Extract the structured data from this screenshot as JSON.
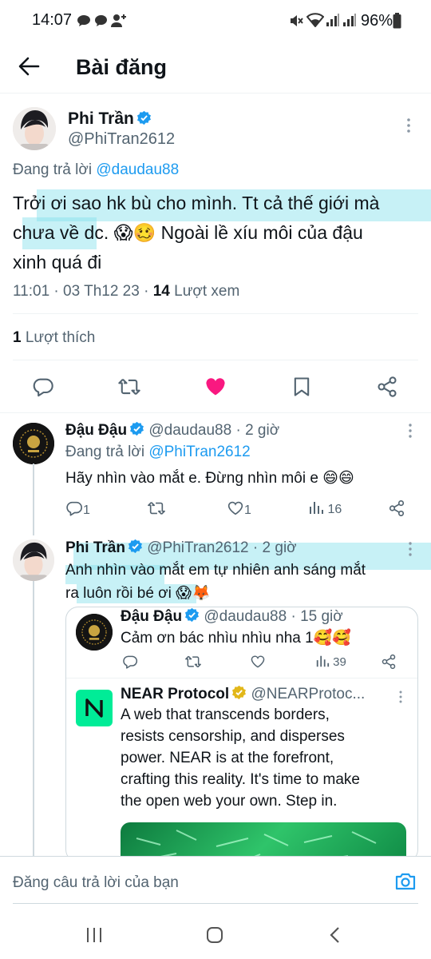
{
  "status_bar": {
    "time": "14:07",
    "battery": "96%",
    "icons": [
      "chat-bubble-icon",
      "chat-bubble-icon",
      "heart-icon",
      "add-person-icon",
      "mute-icon",
      "wifi-icon",
      "signal-icon",
      "signal-icon",
      "battery-icon"
    ]
  },
  "header": {
    "title": "Bài đăng",
    "back_icon": "arrow-left-icon"
  },
  "main_post": {
    "name": "Phi Trần",
    "handle": "@PhiTran2612",
    "replying_prefix": "Đang trả lời ",
    "replying_to": "@daudau88",
    "text_line1": "Trởi ơi sao hk bù cho mình. Tt cả thế giới mà",
    "text_line2": "chưa về dc. 😱🥴 Ngoài lề xíu môi của đậu",
    "text_line3": "xinh quá đi",
    "meta_time": "11:01 · 03 Th12 23 · ",
    "views_count": "14",
    "views_label": " Lượt xem",
    "likes_count": "1",
    "likes_label": " Lượt thích"
  },
  "reply1": {
    "name": "Đậu Đậu",
    "handle": "@daudau88",
    "time": " · 2 giờ",
    "replying_prefix": "Đang trả lời ",
    "replying_to": "@PhiTran2612",
    "text": "Hãy nhìn vào mắt e. Đừng nhìn môi e 😄😄",
    "reply_count": "1",
    "like_count": "1",
    "view_count": "16"
  },
  "reply2": {
    "name": "Phi Trần",
    "handle": "@PhiTran2612",
    "time": " · 2 giờ",
    "text_line1": "Anh nhìn vào mắt em tự nhiên anh sáng mắt",
    "text_line2": "ra luôn rồi bé ơi 😱🦊"
  },
  "quote": {
    "name": "Đậu Đậu",
    "handle": "@daudau88",
    "time": " · 15 giờ",
    "text": "Cảm ơn bác nhìu nhìu nha 1🥰🥰",
    "view_count": "39"
  },
  "near": {
    "name": "NEAR Protocol",
    "handle": "@NEARProtoc...",
    "line1": "A web that transcends borders,",
    "line2": "resists censorship, and disperses",
    "line3": "power. NEAR is at the forefront,",
    "line4": "crafting this reality. It's time to make",
    "line5": "the open web your own. Step in."
  },
  "composer": {
    "placeholder": "Đăng câu trả lời của bạn"
  },
  "colors": {
    "accent": "#1d9bf0",
    "like": "#f91880",
    "near_green": "#00ec97"
  }
}
